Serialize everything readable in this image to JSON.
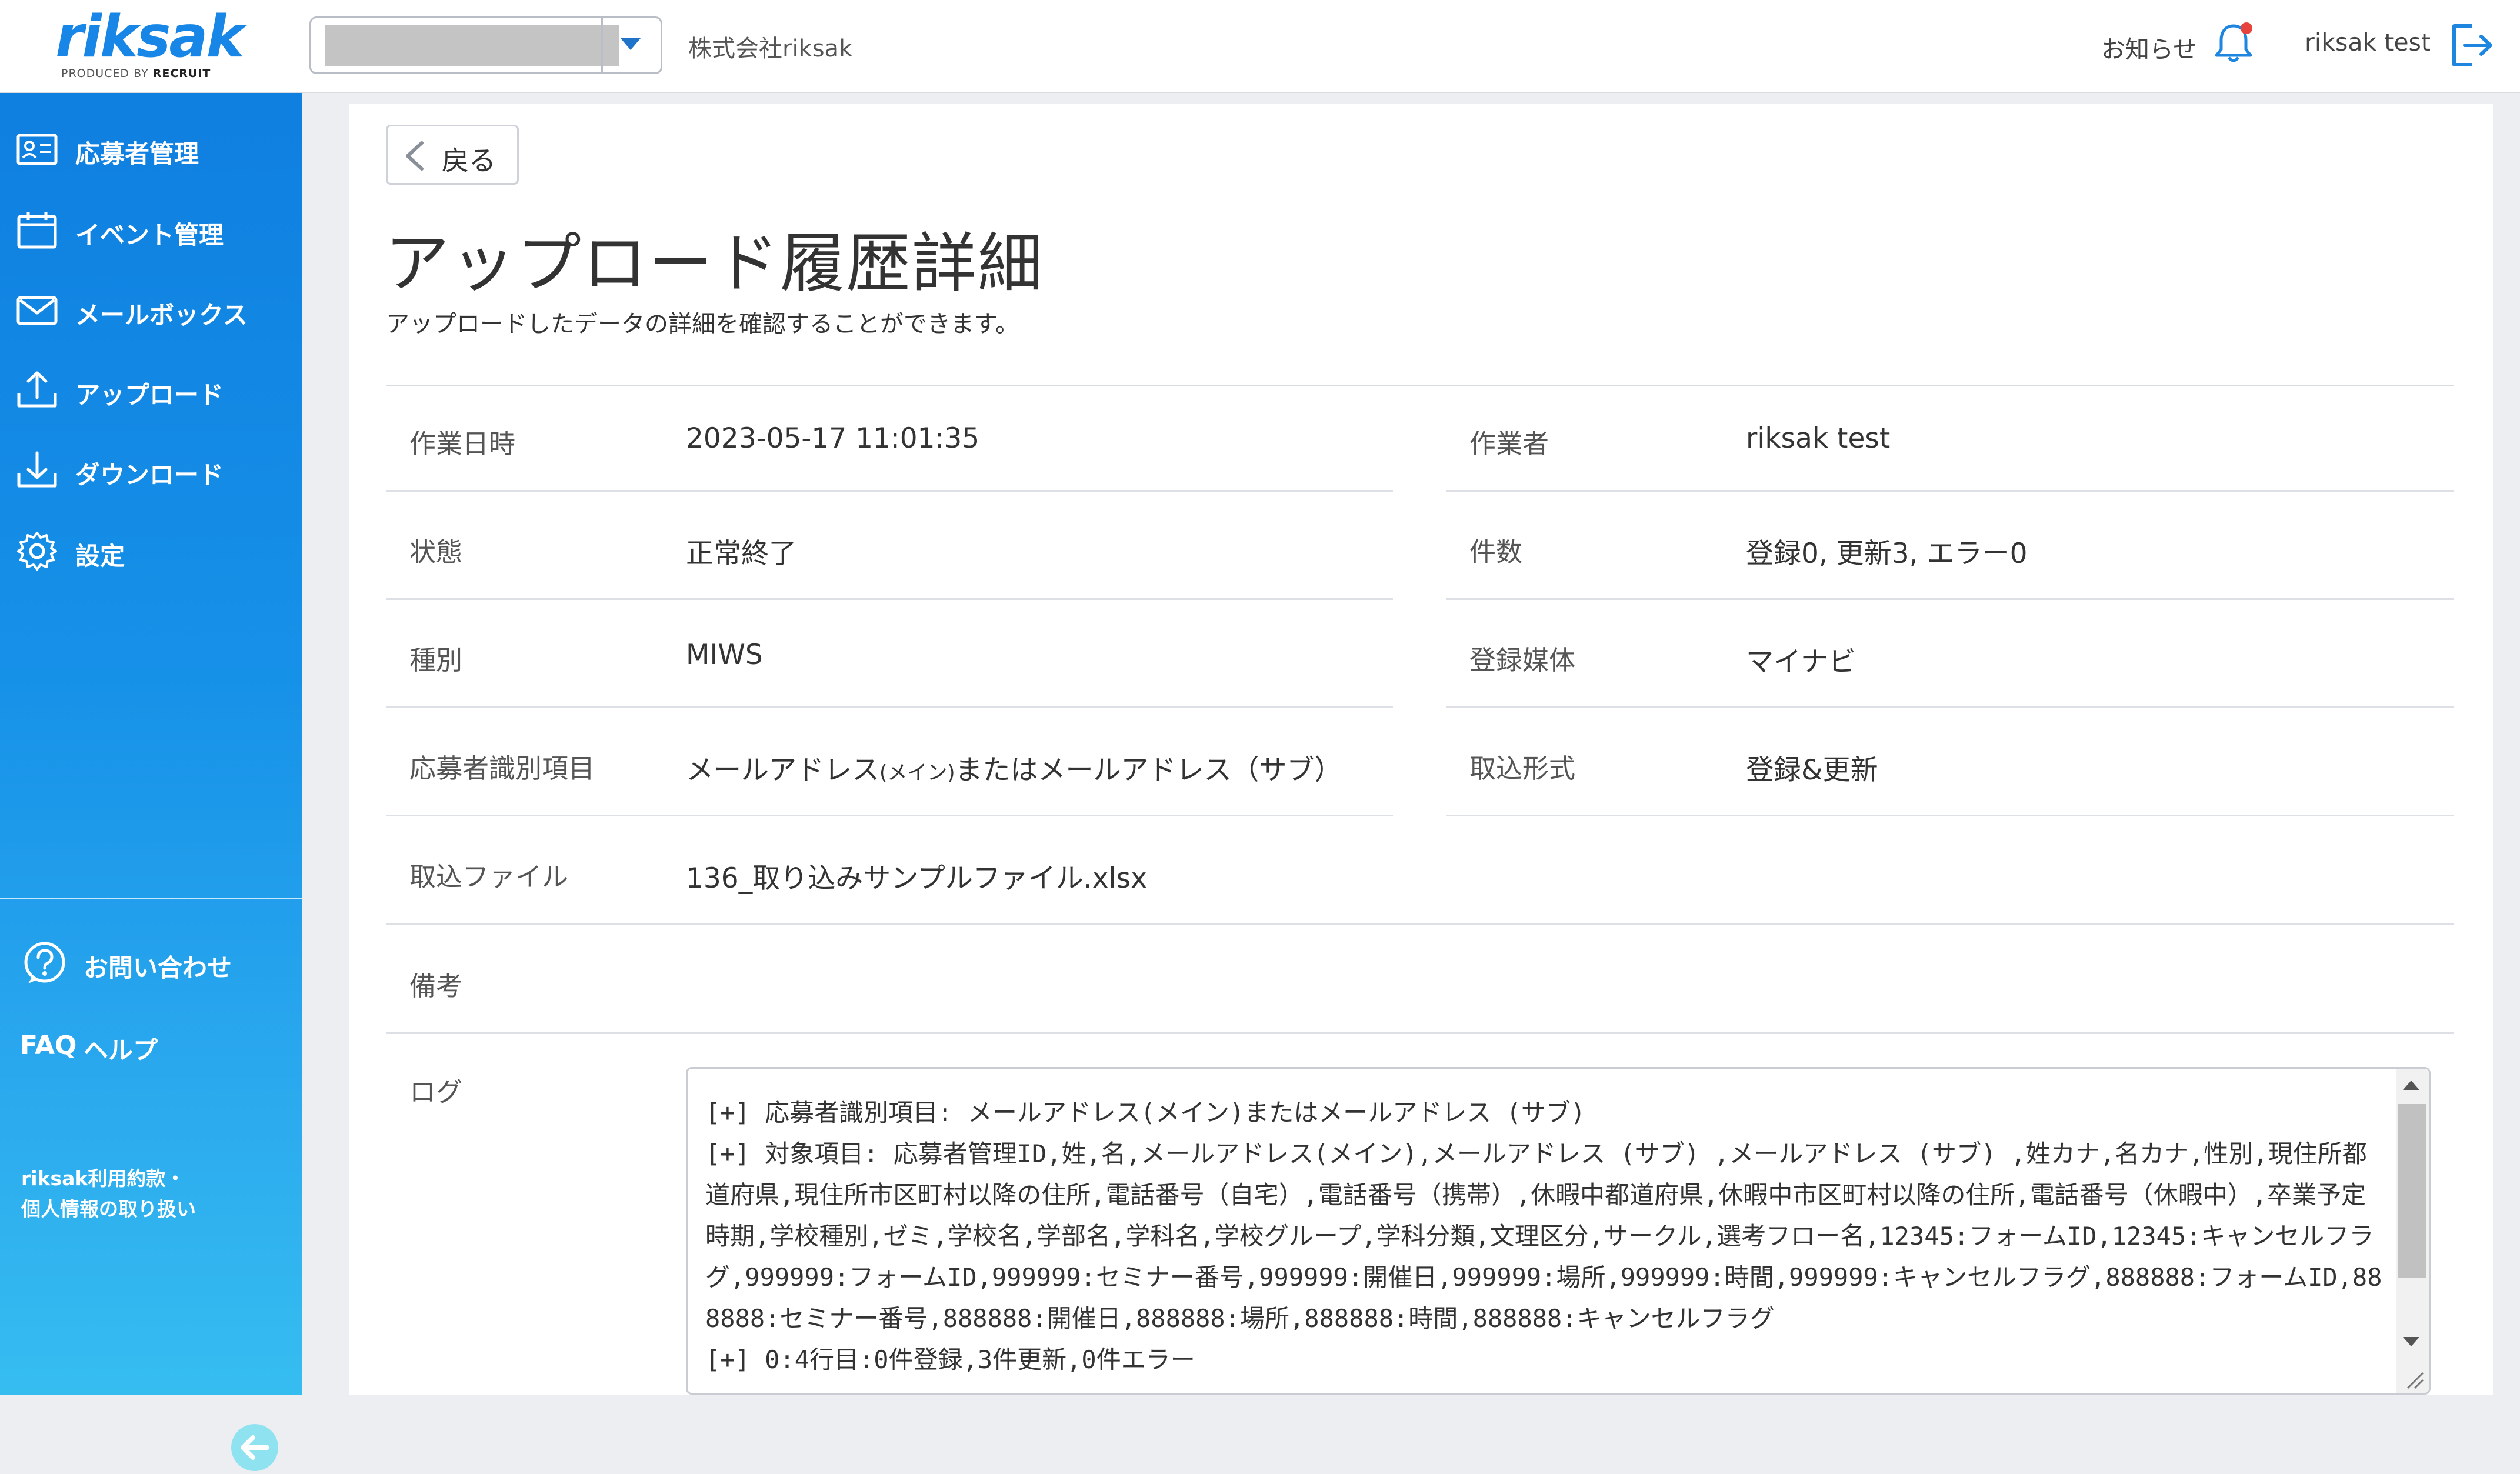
{
  "header": {
    "logo_text": "riksak",
    "logo_sub_prefix": "PRODUCED BY",
    "logo_sub_brand": "RECRUIT",
    "company_name": "株式会社riksak",
    "notice_label": "お知らせ",
    "user_name": "riksak  test"
  },
  "sidebar": {
    "items": [
      {
        "label": "応募者管理",
        "icon": "applicant-card-icon"
      },
      {
        "label": "イベント管理",
        "icon": "calendar-icon"
      },
      {
        "label": "メールボックス",
        "icon": "mail-icon"
      },
      {
        "label": "アップロード",
        "icon": "upload-icon"
      },
      {
        "label": "ダウンロード",
        "icon": "download-icon"
      },
      {
        "label": "設定",
        "icon": "gear-icon"
      }
    ],
    "contact_label": "お問い合わせ",
    "faq_icon_text": "FAQ",
    "faq_label": "ヘルプ",
    "terms_line1": "riksak利用約款・",
    "terms_line2": "個人情報の取り扱い"
  },
  "main": {
    "back_label": "戻る",
    "title": "アップロード履歴詳細",
    "description": "アップロードしたデータの詳細を確認することができます。",
    "fields": {
      "work_datetime": {
        "label": "作業日時",
        "value": "2023-05-17 11:01:35"
      },
      "worker": {
        "label": "作業者",
        "value": "riksak test"
      },
      "status": {
        "label": "状態",
        "value": "正常終了"
      },
      "count": {
        "label": "件数",
        "value": "登録0, 更新3, エラー0"
      },
      "type": {
        "label": "種別",
        "value": "MIWS"
      },
      "media": {
        "label": "登録媒体",
        "value": "マイナビ"
      },
      "identifier": {
        "label": "応募者識別項目",
        "value_a": "メールアドレス",
        "value_b": "(メイン)",
        "value_c": "またはメールアドレス（サブ）"
      },
      "import_format": {
        "label": "取込形式",
        "value": "登録&更新"
      },
      "import_file": {
        "label": "取込ファイル",
        "value": "136_取り込みサンプルファイル.xlsx"
      },
      "remarks": {
        "label": "備考",
        "value": ""
      }
    },
    "log_label": "ログ",
    "log_text": "[+] 応募者識別項目: メールアドレス(メイン)またはメールアドレス (サブ)\n[+] 対象項目: 応募者管理ID,姓,名,メールアドレス(メイン),メールアドレス (サブ) ,メールアドレス (サブ) ,姓カナ,名カナ,性別,現住所都道府県,現住所市区町村以降の住所,電話番号（自宅）,電話番号（携帯）,休暇中都道府県,休暇中市区町村以降の住所,電話番号（休暇中）,卒業予定時期,学校種別,ゼミ,学校名,学部名,学科名,学校グループ,学科分類,文理区分,サークル,選考フロー名,12345:フォームID,12345:キャンセルフラグ,999999:フォームID,999999:セミナー番号,999999:開催日,999999:場所,999999:時間,999999:キャンセルフラグ,888888:フォームID,888888:セミナー番号,888888:開催日,888888:場所,888888:時間,888888:キャンセルフラグ\n[+] 0:4行目:0件登録,3件更新,0件エラー"
  }
}
